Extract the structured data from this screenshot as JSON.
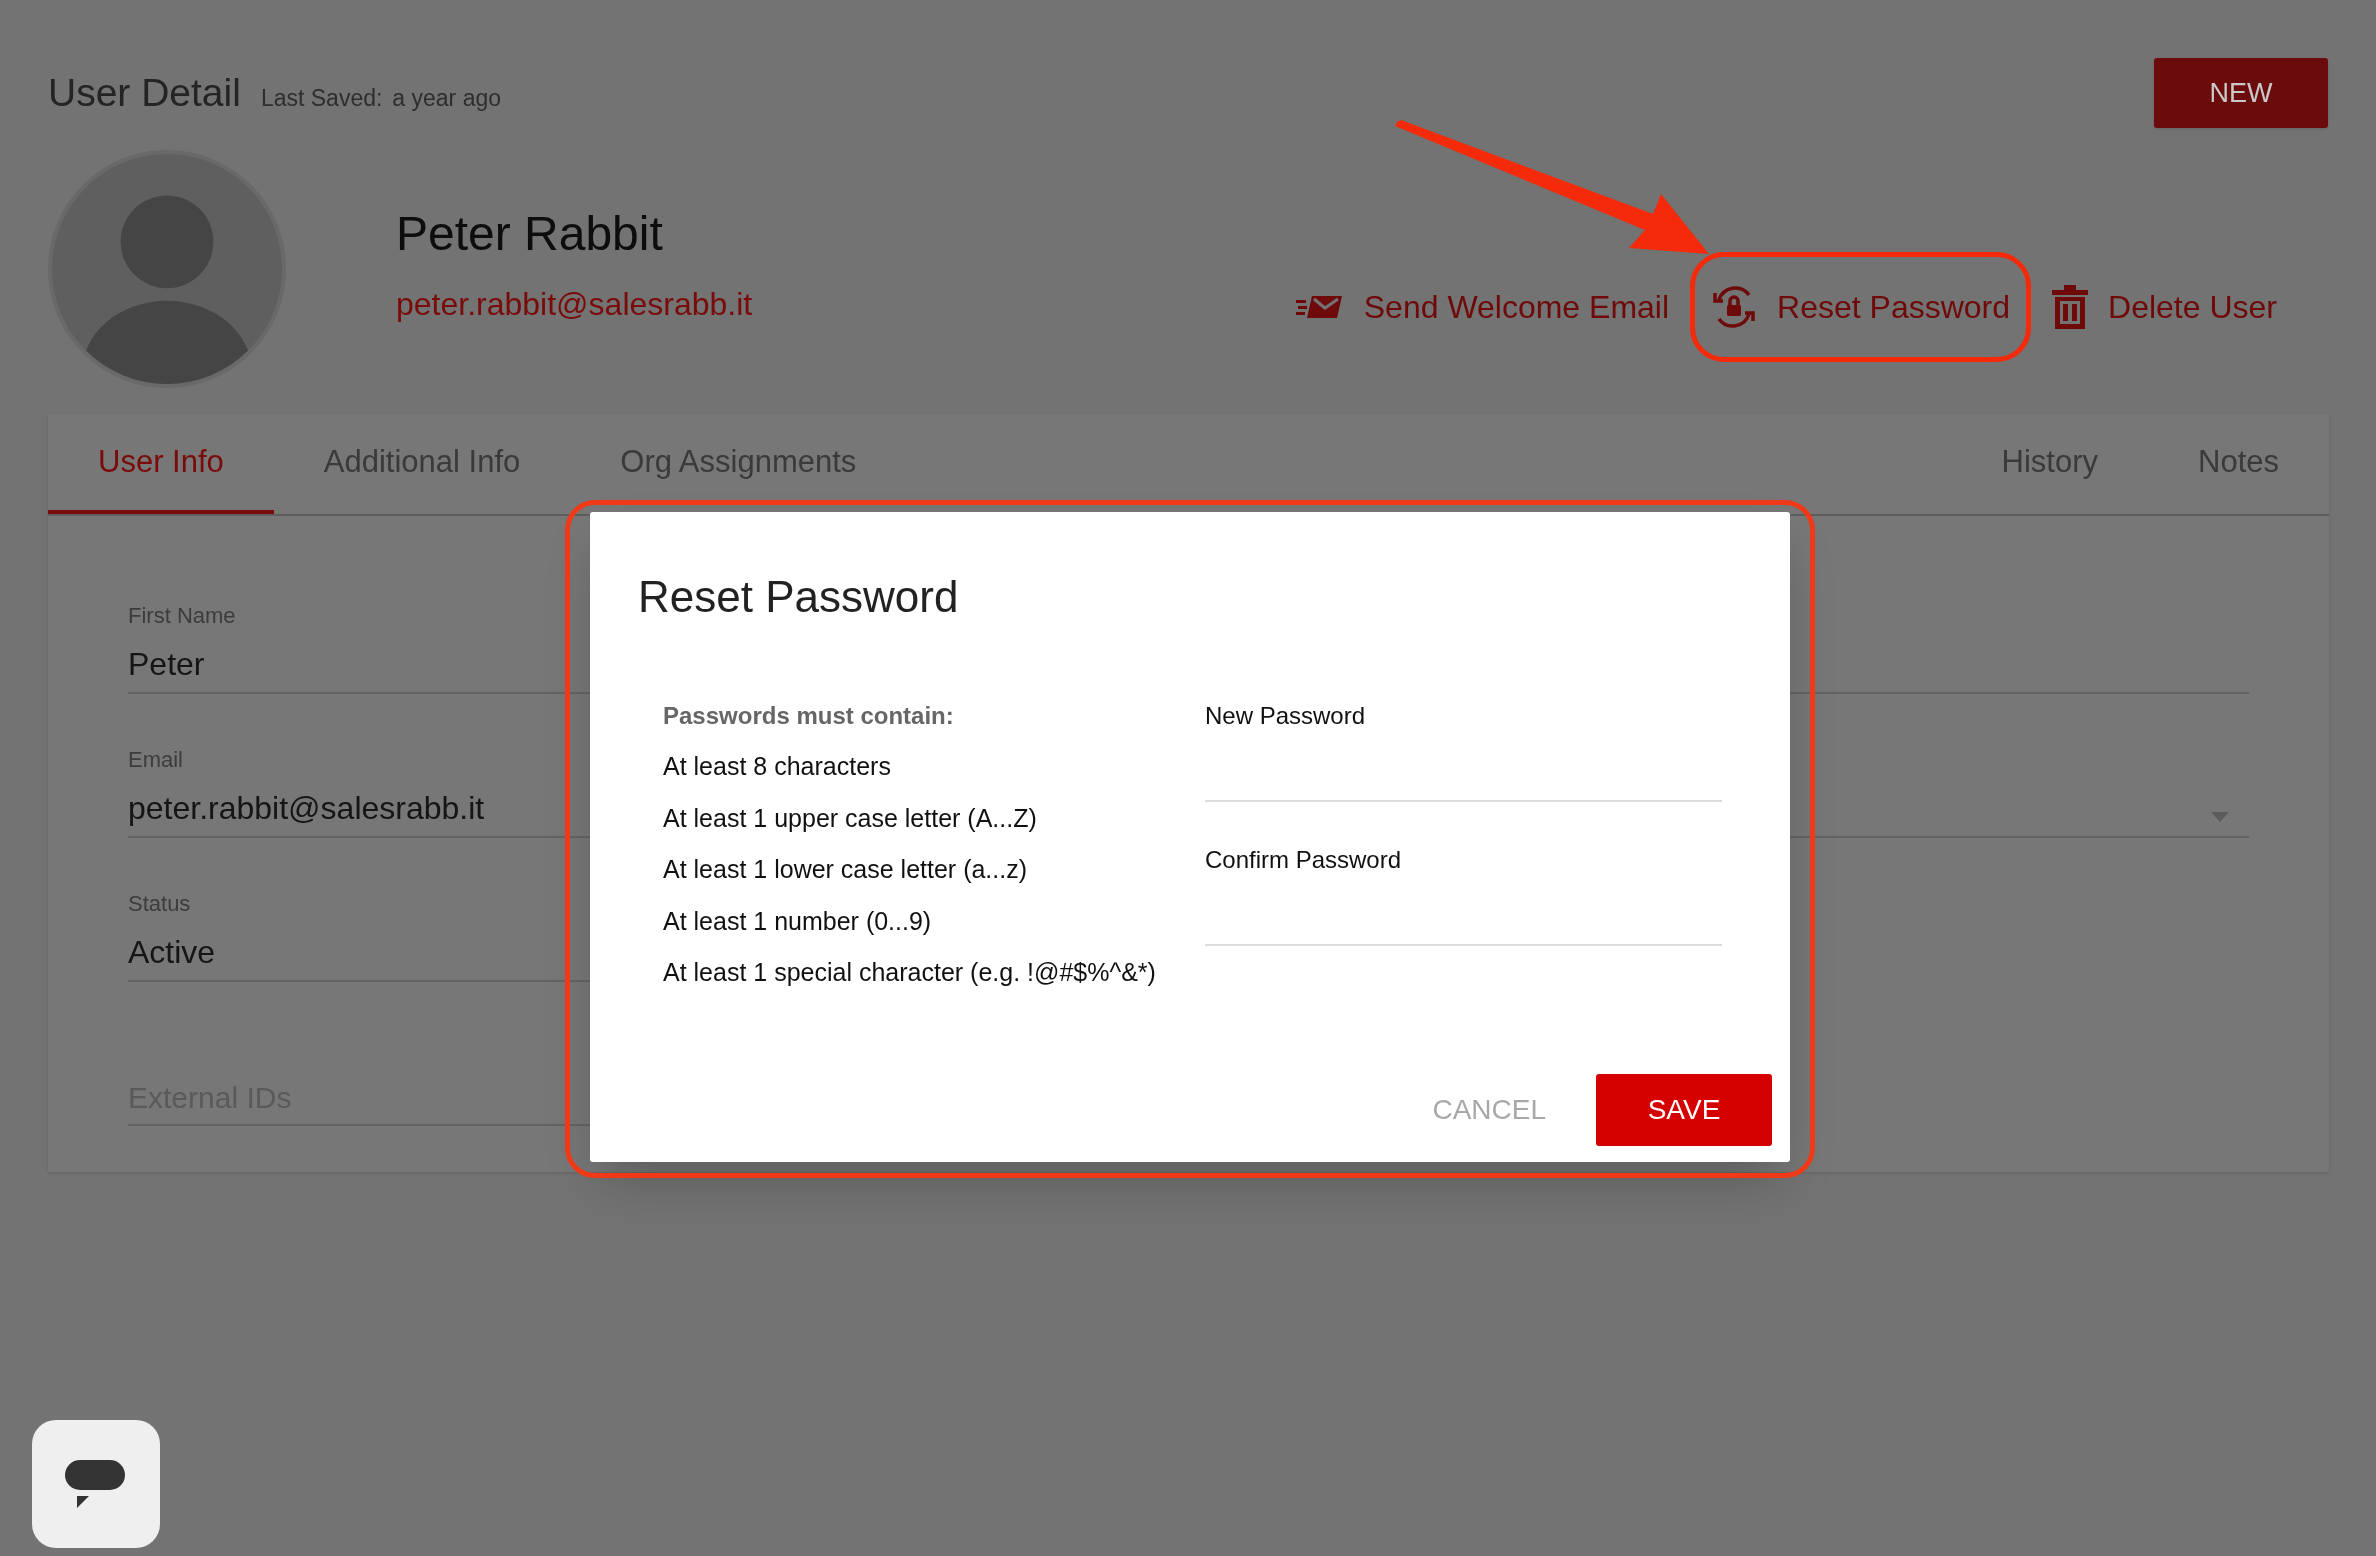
{
  "header": {
    "title": "User Detail",
    "last_saved_label": "Last Saved:",
    "last_saved_value": "a year ago",
    "new_button": "NEW"
  },
  "user": {
    "name": "Peter Rabbit",
    "email": "peter.rabbit@salesrabb.it"
  },
  "actions": [
    {
      "kind": "email",
      "label": "Send Welcome Email",
      "highlighted": false
    },
    {
      "kind": "reset",
      "label": "Reset Password",
      "highlighted": true
    },
    {
      "kind": "delete",
      "label": "Delete User",
      "highlighted": false
    }
  ],
  "annotation_arrow": true,
  "tabs": {
    "left": [
      {
        "label": "User Info",
        "selected": true
      },
      {
        "label": "Additional Info",
        "selected": false
      },
      {
        "label": "Org Assignments",
        "selected": false
      }
    ],
    "right": [
      {
        "label": "History",
        "selected": false
      },
      {
        "label": "Notes",
        "selected": false
      }
    ]
  },
  "fields": [
    {
      "label": "First Name",
      "value": "Peter"
    },
    {
      "label": "Email",
      "value": "peter.rabbit@salesrabb.it"
    },
    {
      "label": "Status",
      "value": "Active"
    },
    {
      "placeholder": "External IDs"
    }
  ],
  "dialog": {
    "title": "Reset Password",
    "highlighted": true,
    "rules_heading": "Passwords must contain:",
    "rules": [
      "At least 8 characters",
      "At least 1 upper case letter (A...Z)",
      "At least 1 lower case letter (a...z)",
      "At least 1 number (0...9)",
      "At least 1 special character (e.g. !@#$%^&*)"
    ],
    "inputs": [
      {
        "label": "New Password"
      },
      {
        "label": "Confirm Password"
      }
    ],
    "cancel": "CANCEL",
    "save": "SAVE"
  }
}
